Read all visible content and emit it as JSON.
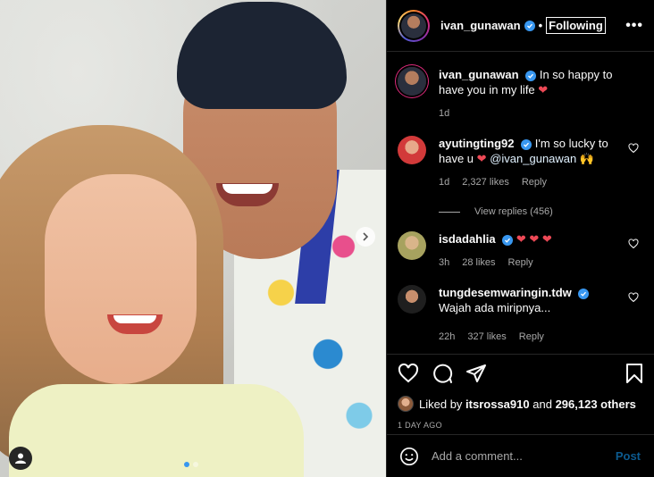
{
  "post": {
    "username": "ivan_gunawan",
    "follow_status": "Following",
    "more": "•••",
    "photo_dots": 2,
    "active_dot": 0
  },
  "comments": [
    {
      "username": "ivan_gunawan",
      "text": "In so happy to have you in my life",
      "emoji": "❤",
      "time": "1d",
      "likes": "",
      "reply": "",
      "is_caption": true
    },
    {
      "username": "ayutingting92",
      "text": "I'm so lucky to have u",
      "emoji": "❤",
      "mention": "@ivan_gunawan",
      "emoji2": "🙌",
      "time": "1d",
      "likes": "2,327 likes",
      "reply": "Reply"
    },
    {
      "username": "isdadahlia",
      "text": "",
      "emoji": "❤ ❤ ❤",
      "time": "3h",
      "likes": "28 likes",
      "reply": "Reply"
    },
    {
      "username": "tungdesemwaringin.tdw",
      "text": "Wajah ada miripnya...",
      "time": "22h",
      "likes": "327 likes",
      "reply": "Reply"
    }
  ],
  "view_replies": "View replies (456)",
  "likes_summary": {
    "prefix": "Liked by",
    "user": "itsrossa910",
    "middle": "and",
    "count": "296,123 others"
  },
  "time_ago": "1 DAY AGO",
  "add_comment": {
    "placeholder": "Add a comment...",
    "post_label": "Post"
  }
}
